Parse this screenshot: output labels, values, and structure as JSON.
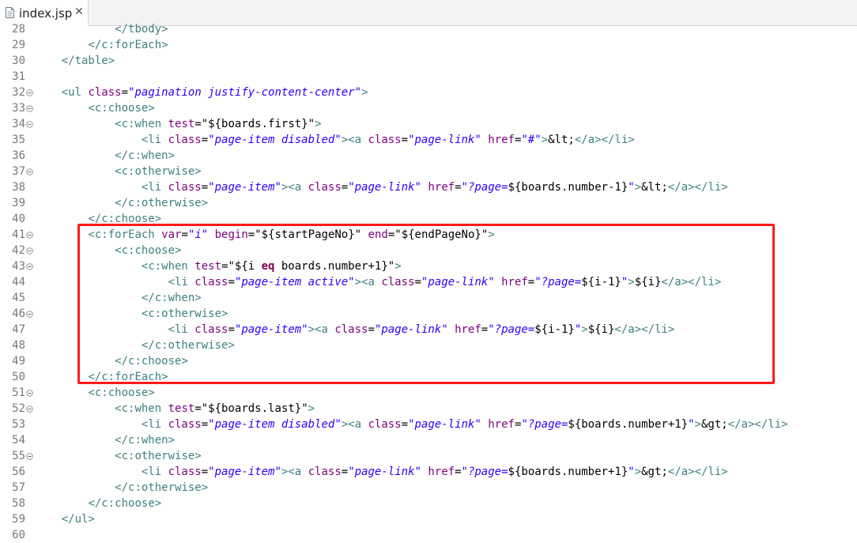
{
  "tab": {
    "title": "index.jsp",
    "close_glyph": "✕",
    "icon": "file-icon"
  },
  "editor": {
    "fold_icon": "fold-minus-icon",
    "highlight_color": "#ff1a1a",
    "highlight_from_line": "41",
    "highlight_to_line": "50",
    "lines": [
      {
        "n": "28",
        "fold": false,
        "indent": "            ",
        "tokens": [
          {
            "t": "</",
            "c": "tag"
          },
          {
            "t": "tbody",
            "c": "tag"
          },
          {
            "t": ">",
            "c": "tag"
          }
        ]
      },
      {
        "n": "29",
        "fold": false,
        "indent": "        ",
        "tokens": [
          {
            "t": "</",
            "c": "tag"
          },
          {
            "t": "c:forEach",
            "c": "tag"
          },
          {
            "t": ">",
            "c": "tag"
          }
        ]
      },
      {
        "n": "30",
        "fold": false,
        "indent": "    ",
        "tokens": [
          {
            "t": "</",
            "c": "tag"
          },
          {
            "t": "table",
            "c": "tag"
          },
          {
            "t": ">",
            "c": "tag"
          }
        ]
      },
      {
        "n": "31",
        "fold": false,
        "indent": "",
        "tokens": []
      },
      {
        "n": "32",
        "fold": true,
        "indent": "    ",
        "tokens": [
          {
            "t": "<ul ",
            "c": "tag"
          },
          {
            "t": "class",
            "c": "attr"
          },
          {
            "t": "=",
            "c": "el"
          },
          {
            "t": "\"pagination justify-content-center\"",
            "c": "str"
          },
          {
            "t": ">",
            "c": "tag"
          }
        ]
      },
      {
        "n": "33",
        "fold": true,
        "indent": "        ",
        "tokens": [
          {
            "t": "<c:choose>",
            "c": "tag"
          }
        ]
      },
      {
        "n": "34",
        "fold": true,
        "indent": "            ",
        "tokens": [
          {
            "t": "<c:when ",
            "c": "tag"
          },
          {
            "t": "test",
            "c": "attr"
          },
          {
            "t": "=\"",
            "c": "el"
          },
          {
            "t": "${boards.first}",
            "c": "el"
          },
          {
            "t": "\"",
            "c": "el"
          },
          {
            "t": ">",
            "c": "tag"
          }
        ]
      },
      {
        "n": "35",
        "fold": false,
        "indent": "                ",
        "tokens": [
          {
            "t": "<li ",
            "c": "tag"
          },
          {
            "t": "class",
            "c": "attr"
          },
          {
            "t": "=",
            "c": "el"
          },
          {
            "t": "\"page-item disabled\"",
            "c": "str"
          },
          {
            "t": "><a ",
            "c": "tag"
          },
          {
            "t": "class",
            "c": "attr"
          },
          {
            "t": "=",
            "c": "el"
          },
          {
            "t": "\"page-link\"",
            "c": "str"
          },
          {
            "t": " ",
            "c": "el"
          },
          {
            "t": "href",
            "c": "attr"
          },
          {
            "t": "=",
            "c": "el"
          },
          {
            "t": "\"#\"",
            "c": "str"
          },
          {
            "t": ">",
            "c": "tag"
          },
          {
            "t": "&lt;",
            "c": "ent"
          },
          {
            "t": "</a></li>",
            "c": "tag"
          }
        ]
      },
      {
        "n": "36",
        "fold": false,
        "indent": "            ",
        "tokens": [
          {
            "t": "</c:when>",
            "c": "tag"
          }
        ]
      },
      {
        "n": "37",
        "fold": true,
        "indent": "            ",
        "tokens": [
          {
            "t": "<c:otherwise>",
            "c": "tag"
          }
        ]
      },
      {
        "n": "38",
        "fold": false,
        "indent": "                ",
        "tokens": [
          {
            "t": "<li ",
            "c": "tag"
          },
          {
            "t": "class",
            "c": "attr"
          },
          {
            "t": "=",
            "c": "el"
          },
          {
            "t": "\"page-item\"",
            "c": "str"
          },
          {
            "t": "><a ",
            "c": "tag"
          },
          {
            "t": "class",
            "c": "attr"
          },
          {
            "t": "=",
            "c": "el"
          },
          {
            "t": "\"page-link\"",
            "c": "str"
          },
          {
            "t": " ",
            "c": "el"
          },
          {
            "t": "href",
            "c": "attr"
          },
          {
            "t": "=",
            "c": "el"
          },
          {
            "t": "\"?page=",
            "c": "str"
          },
          {
            "t": "${boards.number-1}",
            "c": "el"
          },
          {
            "t": "\"",
            "c": "str"
          },
          {
            "t": ">",
            "c": "tag"
          },
          {
            "t": "&lt;",
            "c": "ent"
          },
          {
            "t": "</a></li>",
            "c": "tag"
          }
        ]
      },
      {
        "n": "39",
        "fold": false,
        "indent": "            ",
        "tokens": [
          {
            "t": "</c:otherwise>",
            "c": "tag"
          }
        ]
      },
      {
        "n": "40",
        "fold": false,
        "indent": "        ",
        "tokens": [
          {
            "t": "</c:choose>",
            "c": "tag"
          }
        ]
      },
      {
        "n": "41",
        "fold": true,
        "indent": "        ",
        "tokens": [
          {
            "t": "<c:forEach ",
            "c": "tag"
          },
          {
            "t": "var",
            "c": "attr"
          },
          {
            "t": "=",
            "c": "el"
          },
          {
            "t": "\"i\"",
            "c": "str"
          },
          {
            "t": " ",
            "c": "el"
          },
          {
            "t": "begin",
            "c": "attr"
          },
          {
            "t": "=\"",
            "c": "el"
          },
          {
            "t": "${startPageNo}",
            "c": "el"
          },
          {
            "t": "\"",
            "c": "el"
          },
          {
            "t": " ",
            "c": "el"
          },
          {
            "t": "end",
            "c": "attr"
          },
          {
            "t": "=\"",
            "c": "el"
          },
          {
            "t": "${endPageNo}",
            "c": "el"
          },
          {
            "t": "\"",
            "c": "el"
          },
          {
            "t": ">",
            "c": "tag"
          }
        ]
      },
      {
        "n": "42",
        "fold": true,
        "indent": "            ",
        "tokens": [
          {
            "t": "<c:choose>",
            "c": "tag"
          }
        ]
      },
      {
        "n": "43",
        "fold": true,
        "indent": "                ",
        "tokens": [
          {
            "t": "<c:when ",
            "c": "tag"
          },
          {
            "t": "test",
            "c": "attr"
          },
          {
            "t": "=\"",
            "c": "el"
          },
          {
            "t": "${i ",
            "c": "el"
          },
          {
            "t": "eq",
            "c": "kw"
          },
          {
            "t": " boards.number+1}",
            "c": "el"
          },
          {
            "t": "\"",
            "c": "el"
          },
          {
            "t": ">",
            "c": "tag"
          }
        ]
      },
      {
        "n": "44",
        "fold": false,
        "indent": "                    ",
        "tokens": [
          {
            "t": "<li ",
            "c": "tag"
          },
          {
            "t": "class",
            "c": "attr"
          },
          {
            "t": "=",
            "c": "el"
          },
          {
            "t": "\"page-item active\"",
            "c": "str"
          },
          {
            "t": "><a ",
            "c": "tag"
          },
          {
            "t": "class",
            "c": "attr"
          },
          {
            "t": "=",
            "c": "el"
          },
          {
            "t": "\"page-link\"",
            "c": "str"
          },
          {
            "t": " ",
            "c": "el"
          },
          {
            "t": "href",
            "c": "attr"
          },
          {
            "t": "=",
            "c": "el"
          },
          {
            "t": "\"?page=",
            "c": "str"
          },
          {
            "t": "${i-1}",
            "c": "el"
          },
          {
            "t": "\"",
            "c": "str"
          },
          {
            "t": ">",
            "c": "tag"
          },
          {
            "t": "${i}",
            "c": "el"
          },
          {
            "t": "</a></li>",
            "c": "tag"
          }
        ]
      },
      {
        "n": "45",
        "fold": false,
        "indent": "                ",
        "tokens": [
          {
            "t": "</c:when>",
            "c": "tag"
          }
        ]
      },
      {
        "n": "46",
        "fold": true,
        "indent": "                ",
        "tokens": [
          {
            "t": "<c:otherwise>",
            "c": "tag"
          }
        ]
      },
      {
        "n": "47",
        "fold": false,
        "indent": "                    ",
        "tokens": [
          {
            "t": "<li ",
            "c": "tag"
          },
          {
            "t": "class",
            "c": "attr"
          },
          {
            "t": "=",
            "c": "el"
          },
          {
            "t": "\"page-item\"",
            "c": "str"
          },
          {
            "t": "><a ",
            "c": "tag"
          },
          {
            "t": "class",
            "c": "attr"
          },
          {
            "t": "=",
            "c": "el"
          },
          {
            "t": "\"page-link\"",
            "c": "str"
          },
          {
            "t": " ",
            "c": "el"
          },
          {
            "t": "href",
            "c": "attr"
          },
          {
            "t": "=",
            "c": "el"
          },
          {
            "t": "\"?page=",
            "c": "str"
          },
          {
            "t": "${i-1}",
            "c": "el"
          },
          {
            "t": "\"",
            "c": "str"
          },
          {
            "t": ">",
            "c": "tag"
          },
          {
            "t": "${i}",
            "c": "el"
          },
          {
            "t": "</a></li>",
            "c": "tag"
          }
        ]
      },
      {
        "n": "48",
        "fold": false,
        "indent": "                ",
        "tokens": [
          {
            "t": "</c:otherwise>",
            "c": "tag"
          }
        ]
      },
      {
        "n": "49",
        "fold": false,
        "indent": "            ",
        "tokens": [
          {
            "t": "</c:choose>",
            "c": "tag"
          }
        ]
      },
      {
        "n": "50",
        "fold": false,
        "indent": "        ",
        "tokens": [
          {
            "t": "</c:forEach>",
            "c": "tag"
          }
        ]
      },
      {
        "n": "51",
        "fold": true,
        "indent": "        ",
        "tokens": [
          {
            "t": "<c:choose>",
            "c": "tag"
          }
        ]
      },
      {
        "n": "52",
        "fold": true,
        "indent": "            ",
        "tokens": [
          {
            "t": "<c:when ",
            "c": "tag"
          },
          {
            "t": "test",
            "c": "attr"
          },
          {
            "t": "=\"",
            "c": "el"
          },
          {
            "t": "${boards.last}",
            "c": "el"
          },
          {
            "t": "\"",
            "c": "el"
          },
          {
            "t": ">",
            "c": "tag"
          }
        ]
      },
      {
        "n": "53",
        "fold": false,
        "indent": "                ",
        "tokens": [
          {
            "t": "<li ",
            "c": "tag"
          },
          {
            "t": "class",
            "c": "attr"
          },
          {
            "t": "=",
            "c": "el"
          },
          {
            "t": "\"page-item disabled\"",
            "c": "str"
          },
          {
            "t": "><a ",
            "c": "tag"
          },
          {
            "t": "class",
            "c": "attr"
          },
          {
            "t": "=",
            "c": "el"
          },
          {
            "t": "\"page-link\"",
            "c": "str"
          },
          {
            "t": " ",
            "c": "el"
          },
          {
            "t": "href",
            "c": "attr"
          },
          {
            "t": "=",
            "c": "el"
          },
          {
            "t": "\"?page=",
            "c": "str"
          },
          {
            "t": "${boards.number+1}",
            "c": "el"
          },
          {
            "t": "\"",
            "c": "str"
          },
          {
            "t": ">",
            "c": "tag"
          },
          {
            "t": "&gt;",
            "c": "ent"
          },
          {
            "t": "</a></li>",
            "c": "tag"
          }
        ]
      },
      {
        "n": "54",
        "fold": false,
        "indent": "            ",
        "tokens": [
          {
            "t": "</c:when>",
            "c": "tag"
          }
        ]
      },
      {
        "n": "55",
        "fold": true,
        "indent": "            ",
        "tokens": [
          {
            "t": "<c:otherwise>",
            "c": "tag"
          }
        ]
      },
      {
        "n": "56",
        "fold": false,
        "indent": "                ",
        "tokens": [
          {
            "t": "<li ",
            "c": "tag"
          },
          {
            "t": "class",
            "c": "attr"
          },
          {
            "t": "=",
            "c": "el"
          },
          {
            "t": "\"page-item\"",
            "c": "str"
          },
          {
            "t": "><a ",
            "c": "tag"
          },
          {
            "t": "class",
            "c": "attr"
          },
          {
            "t": "=",
            "c": "el"
          },
          {
            "t": "\"page-link\"",
            "c": "str"
          },
          {
            "t": " ",
            "c": "el"
          },
          {
            "t": "href",
            "c": "attr"
          },
          {
            "t": "=",
            "c": "el"
          },
          {
            "t": "\"?page=",
            "c": "str"
          },
          {
            "t": "${boards.number+1}",
            "c": "el"
          },
          {
            "t": "\"",
            "c": "str"
          },
          {
            "t": ">",
            "c": "tag"
          },
          {
            "t": "&gt;",
            "c": "ent"
          },
          {
            "t": "</a></li>",
            "c": "tag"
          }
        ]
      },
      {
        "n": "57",
        "fold": false,
        "indent": "            ",
        "tokens": [
          {
            "t": "</c:otherwise>",
            "c": "tag"
          }
        ]
      },
      {
        "n": "58",
        "fold": false,
        "indent": "        ",
        "tokens": [
          {
            "t": "</c:choose>",
            "c": "tag"
          }
        ]
      },
      {
        "n": "59",
        "fold": false,
        "indent": "    ",
        "tokens": [
          {
            "t": "</ul>",
            "c": "tag"
          }
        ]
      },
      {
        "n": "60",
        "fold": false,
        "indent": "",
        "tokens": []
      }
    ]
  }
}
